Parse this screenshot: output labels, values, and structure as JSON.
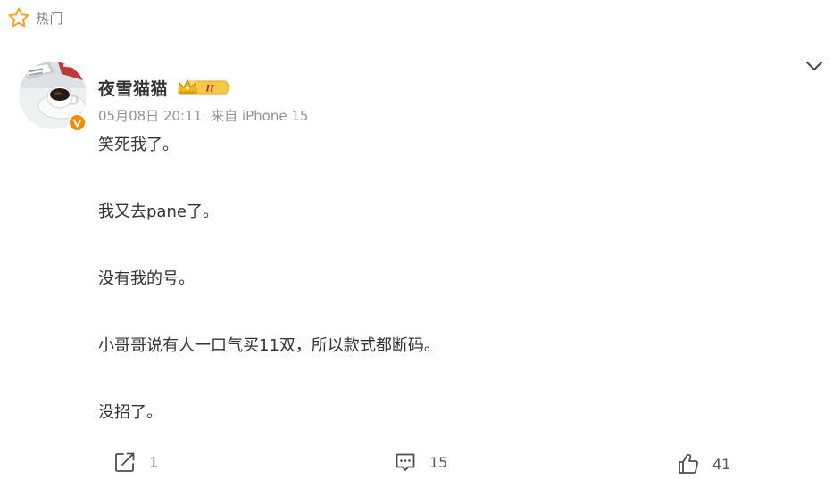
{
  "hot_tag": {
    "icon": "star-outline-icon",
    "label": "热门",
    "icon_color": "#f5a623"
  },
  "post": {
    "author": {
      "name": "夜雪猫猫",
      "avatar_icon": "coffee-cup-avatar",
      "verified_icon": "verified-v-icon",
      "verified_color": "#f28c00",
      "member_badge_icon": "vip-crown-badge-icon",
      "member_badge_level": "II"
    },
    "time": "05月08日 20:11",
    "source": "来自 iPhone 15",
    "more_icon": "chevron-down-icon",
    "content_lines": [
      "笑死我了。",
      "我又去pane了。",
      "没有我的号。",
      "小哥哥说有人一口气买11双，所以款式都断码。",
      "没招了。"
    ]
  },
  "actions": {
    "repost": {
      "icon": "share-icon",
      "count": "1"
    },
    "comment": {
      "icon": "comment-icon",
      "count": "15"
    },
    "like": {
      "icon": "thumbs-up-icon",
      "count": "41"
    }
  },
  "colors": {
    "text": "#333333",
    "meta": "#939393",
    "icon": "#4d4d4d"
  }
}
